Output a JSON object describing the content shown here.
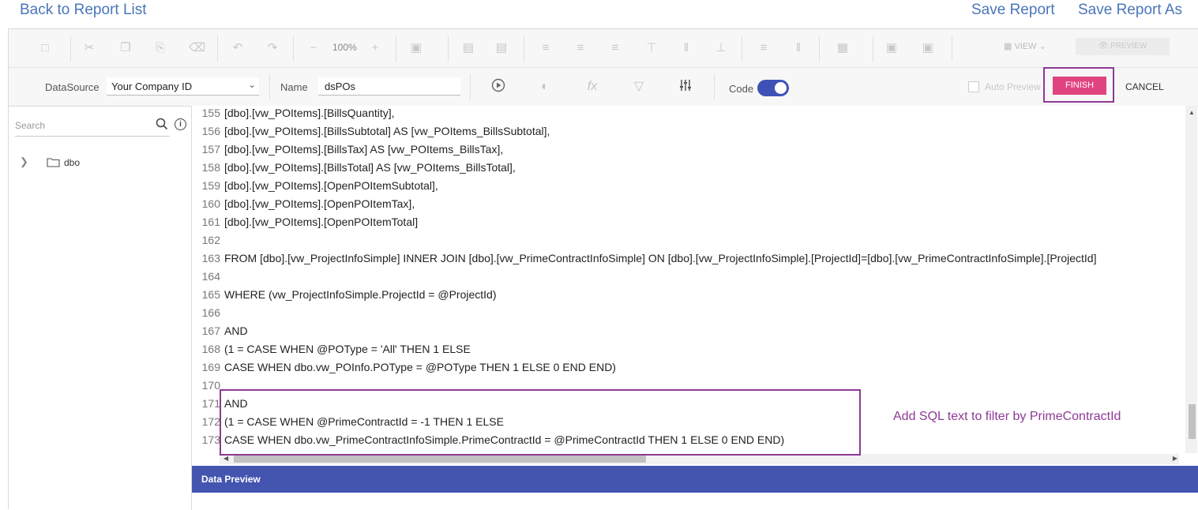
{
  "header": {
    "back_link": "Back to Report List",
    "save_report": "Save Report",
    "save_report_as": "Save Report As"
  },
  "toolbar": {
    "zoom": "100%",
    "view_label": "VIEW",
    "preview_label": "PREVIEW"
  },
  "query_bar": {
    "datasource_label": "DataSource",
    "datasource_value": "Your Company ID",
    "name_label": "Name",
    "name_value": "dsPOs",
    "code_label": "Code",
    "code_toggle_on": true,
    "auto_preview_label": "Auto Preview",
    "finish_label": "FINISH",
    "cancel_label": "CANCEL"
  },
  "sidebar": {
    "search_placeholder": "Search",
    "tree": [
      {
        "label": "dbo"
      }
    ]
  },
  "editor": {
    "lines": [
      {
        "num": "155",
        "text": "[dbo].[vw_POItems].[BillsQuantity],"
      },
      {
        "num": "156",
        "text": "[dbo].[vw_POItems].[BillsSubtotal] AS [vw_POItems_BillsSubtotal],"
      },
      {
        "num": "157",
        "text": "[dbo].[vw_POItems].[BillsTax] AS [vw_POItems_BillsTax],"
      },
      {
        "num": "158",
        "text": "[dbo].[vw_POItems].[BillsTotal] AS [vw_POItems_BillsTotal],"
      },
      {
        "num": "159",
        "text": "[dbo].[vw_POItems].[OpenPOItemSubtotal],"
      },
      {
        "num": "160",
        "text": "[dbo].[vw_POItems].[OpenPOItemTax],"
      },
      {
        "num": "161",
        "text": "[dbo].[vw_POItems].[OpenPOItemTotal]"
      },
      {
        "num": "162",
        "text": ""
      },
      {
        "num": "163",
        "text": "FROM [dbo].[vw_ProjectInfoSimple] INNER JOIN [dbo].[vw_PrimeContractInfoSimple] ON [dbo].[vw_ProjectInfoSimple].[ProjectId]=[dbo].[vw_PrimeContractInfoSimple].[ProjectId]"
      },
      {
        "num": "164",
        "text": ""
      },
      {
        "num": "165",
        "text": "WHERE (vw_ProjectInfoSimple.ProjectId = @ProjectId)"
      },
      {
        "num": "166",
        "text": ""
      },
      {
        "num": "167",
        "text": "AND"
      },
      {
        "num": "168",
        "text": "(1 = CASE WHEN @POType = 'All' THEN 1 ELSE"
      },
      {
        "num": "169",
        "text": "CASE WHEN dbo.vw_POInfo.POType = @POType THEN 1 ELSE 0 END END)"
      },
      {
        "num": "170",
        "text": ""
      },
      {
        "num": "171",
        "text": "AND"
      },
      {
        "num": "172",
        "text": "(1 = CASE WHEN @PrimeContractId = -1 THEN 1 ELSE"
      },
      {
        "num": "173",
        "text": "CASE WHEN dbo.vw_PrimeContractInfoSimple.PrimeContractId = @PrimeContractId THEN 1 ELSE 0 END END)"
      }
    ]
  },
  "annotation": {
    "text": "Add SQL text to filter by PrimeContractId",
    "color": "#8e3a96"
  },
  "data_preview": {
    "title": "Data Preview"
  }
}
